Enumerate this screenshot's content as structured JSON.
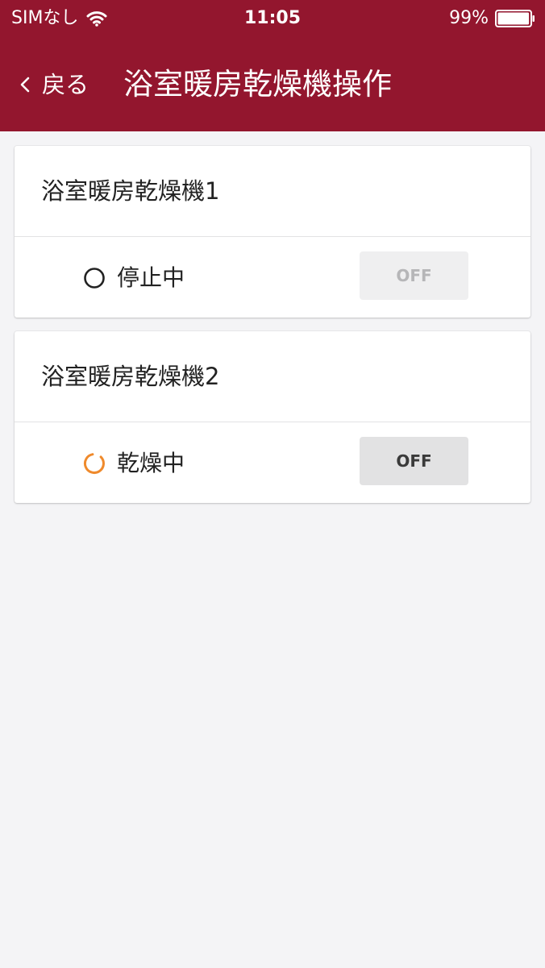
{
  "status_bar": {
    "carrier": "SIMなし",
    "time": "11:05",
    "battery": "99%",
    "wifi_icon": "wifi-icon",
    "battery_icon": "battery-icon",
    "battery_level": 0.99
  },
  "nav": {
    "back_label": "戻る",
    "back_icon": "chevron-left-icon",
    "title": "浴室暖房乾燥機操作"
  },
  "devices": [
    {
      "name": "浴室暖房乾燥機1",
      "status": "停止中",
      "status_icon": "circle-outline-icon",
      "button_label": "OFF",
      "button_enabled": false
    },
    {
      "name": "浴室暖房乾燥機2",
      "status": "乾燥中",
      "status_icon": "spinner-icon",
      "button_label": "OFF",
      "button_enabled": true
    }
  ],
  "colors": {
    "header_bg": "#93162e",
    "page_bg": "#f4f4f6",
    "spinner": "#ef8a2c"
  }
}
